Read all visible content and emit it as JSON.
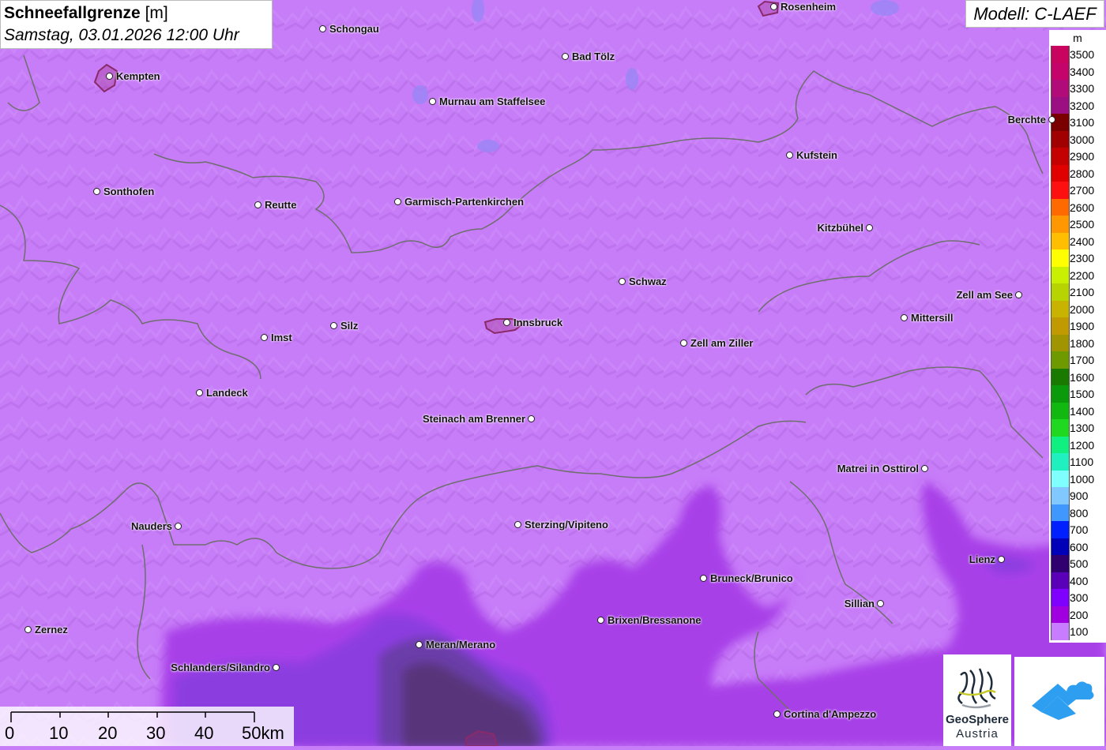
{
  "title": {
    "parameter": "Schneefallgrenze",
    "unit": "[m]",
    "datetime": "Samstag, 03.01.2026 12:00 Uhr"
  },
  "model": "Modell: C-LAEF",
  "legend": {
    "unit": "m",
    "entries": [
      {
        "value": "3500",
        "color": "#c8045e"
      },
      {
        "value": "3400",
        "color": "#c4046b"
      },
      {
        "value": "3300",
        "color": "#b10a79"
      },
      {
        "value": "3200",
        "color": "#9c0f83"
      },
      {
        "value": "3100",
        "color": "#7a0000"
      },
      {
        "value": "3000",
        "color": "#a00000"
      },
      {
        "value": "2900",
        "color": "#c40000"
      },
      {
        "value": "2800",
        "color": "#e00000"
      },
      {
        "value": "2700",
        "color": "#ff1010"
      },
      {
        "value": "2600",
        "color": "#ff6a00"
      },
      {
        "value": "2500",
        "color": "#ff9800"
      },
      {
        "value": "2400",
        "color": "#ffbe00"
      },
      {
        "value": "2300",
        "color": "#ffff00"
      },
      {
        "value": "2200",
        "color": "#c8f000"
      },
      {
        "value": "2100",
        "color": "#b8d400"
      },
      {
        "value": "2000",
        "color": "#c8b400"
      },
      {
        "value": "1900",
        "color": "#c09a00"
      },
      {
        "value": "1800",
        "color": "#a09400"
      },
      {
        "value": "1700",
        "color": "#6e9a00"
      },
      {
        "value": "1600",
        "color": "#1a7a00"
      },
      {
        "value": "1500",
        "color": "#0a9a0a"
      },
      {
        "value": "1400",
        "color": "#10b810"
      },
      {
        "value": "1300",
        "color": "#20d820"
      },
      {
        "value": "1200",
        "color": "#10f080"
      },
      {
        "value": "1100",
        "color": "#20f0c0"
      },
      {
        "value": "1000",
        "color": "#80ffff"
      },
      {
        "value": "900",
        "color": "#80c8ff"
      },
      {
        "value": "800",
        "color": "#4098ff"
      },
      {
        "value": "700",
        "color": "#0020ff"
      },
      {
        "value": "600",
        "color": "#0000b8"
      },
      {
        "value": "500",
        "color": "#300070"
      },
      {
        "value": "400",
        "color": "#5a00b8"
      },
      {
        "value": "300",
        "color": "#8000ff"
      },
      {
        "value": "200",
        "color": "#a000e0"
      },
      {
        "value": "100",
        "color": "#c87cff"
      }
    ]
  },
  "cities": [
    {
      "name": "Rosenheim",
      "side": "right"
    },
    {
      "name": "Schongau",
      "side": "right"
    },
    {
      "name": "Kempten",
      "side": "right"
    },
    {
      "name": "Bad Tölz",
      "side": "right"
    },
    {
      "name": "Murnau am Staffelsee",
      "side": "right"
    },
    {
      "name": "Berchte",
      "side": "left"
    },
    {
      "name": "Kufstein",
      "side": "right"
    },
    {
      "name": "Sonthofen",
      "side": "right"
    },
    {
      "name": "Reutte",
      "side": "right"
    },
    {
      "name": "Garmisch-Partenkirchen",
      "side": "right"
    },
    {
      "name": "Kitzbühel",
      "side": "left"
    },
    {
      "name": "Schwaz",
      "side": "right"
    },
    {
      "name": "Zell am See",
      "side": "left"
    },
    {
      "name": "Mittersill",
      "side": "right"
    },
    {
      "name": "Silz",
      "side": "right"
    },
    {
      "name": "Innsbruck",
      "side": "right"
    },
    {
      "name": "Imst",
      "side": "right"
    },
    {
      "name": "Zell am Ziller",
      "side": "right"
    },
    {
      "name": "Landeck",
      "side": "right"
    },
    {
      "name": "Steinach am Brenner",
      "side": "left"
    },
    {
      "name": "Matrei in Osttirol",
      "side": "left"
    },
    {
      "name": "Nauders",
      "side": "left"
    },
    {
      "name": "Sterzing/Vipiteno",
      "side": "right"
    },
    {
      "name": "Lienz",
      "side": "left"
    },
    {
      "name": "Bruneck/Brunico",
      "side": "right"
    },
    {
      "name": "Sillian",
      "side": "left"
    },
    {
      "name": "Brixen/Bressanone",
      "side": "right"
    },
    {
      "name": "Zernez",
      "side": "right"
    },
    {
      "name": "Meran/Merano",
      "side": "right"
    },
    {
      "name": "Schlanders/Silandro",
      "side": "left"
    },
    {
      "name": "Cortina d'Ampezzo",
      "side": "right"
    }
  ],
  "scalebar": {
    "labels": [
      "0",
      "10",
      "20",
      "30",
      "40",
      "50km"
    ]
  },
  "logos": {
    "geosphere_line1": "GeoSphere",
    "geosphere_line2": "Austria",
    "app_icon": "cloud-logo-icon"
  }
}
